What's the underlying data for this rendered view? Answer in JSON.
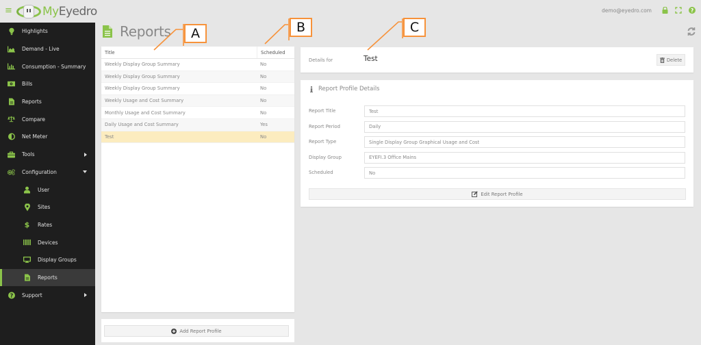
{
  "app": {
    "brand_my": "My",
    "brand_rest": "Eyedro",
    "user_email": "demo@eyedro.com"
  },
  "sidebar": {
    "items": [
      {
        "label": "Highlights",
        "icon": "lightbulb-icon"
      },
      {
        "label": "Demand - Live",
        "icon": "area-chart-icon"
      },
      {
        "label": "Consumption - Summary",
        "icon": "bar-chart-icon"
      },
      {
        "label": "Bills",
        "icon": "money-icon"
      },
      {
        "label": "Reports",
        "icon": "document-icon"
      },
      {
        "label": "Compare",
        "icon": "balance-scale-icon"
      },
      {
        "label": "Net Meter",
        "icon": "half-circle-icon"
      },
      {
        "label": "Tools",
        "icon": "briefcase-icon",
        "expand": "right"
      },
      {
        "label": "Configuration",
        "icon": "cogs-icon",
        "expand": "down"
      },
      {
        "label": "User",
        "icon": "user-icon",
        "sub": true
      },
      {
        "label": "Sites",
        "icon": "map-marker-icon",
        "sub": true
      },
      {
        "label": "Rates",
        "icon": "dollar-icon",
        "sub": true
      },
      {
        "label": "Devices",
        "icon": "barcode-icon",
        "sub": true
      },
      {
        "label": "Display Groups",
        "icon": "monitor-icon",
        "sub": true
      },
      {
        "label": "Reports",
        "icon": "document-icon",
        "sub": true,
        "active": true
      },
      {
        "label": "Support",
        "icon": "question-circle-icon",
        "expand": "right"
      }
    ]
  },
  "page": {
    "title": "Reports"
  },
  "report_list": {
    "columns": [
      "Title",
      "Scheduled"
    ],
    "rows": [
      {
        "title": "Weekly Display Group Summary",
        "scheduled": "No"
      },
      {
        "title": "Weekly Display Group Summary",
        "scheduled": "No"
      },
      {
        "title": "Weekly Display Group Summary",
        "scheduled": "No"
      },
      {
        "title": "Weekly Usage and Cost Summary",
        "scheduled": "No"
      },
      {
        "title": "Monthly Usage and Cost Summary",
        "scheduled": "No"
      },
      {
        "title": "Daily Usage and Cost Summary",
        "scheduled": "Yes"
      },
      {
        "title": "Test",
        "scheduled": "No",
        "selected": true
      }
    ],
    "add_button": "Add Report Profile"
  },
  "details": {
    "label": "Details for",
    "name": "Test",
    "delete_button": "Delete"
  },
  "profile": {
    "title": "Report Profile Details",
    "fields": [
      {
        "label": "Report Title",
        "value": "Test"
      },
      {
        "label": "Report Period",
        "value": "Daily"
      },
      {
        "label": "Report Type",
        "value": "Single Display Group Graphical Usage and Cost"
      },
      {
        "label": "Display Group",
        "value": "EYEFI.3 Office Mains"
      },
      {
        "label": "Scheduled",
        "value": "No"
      }
    ],
    "edit_button": "Edit Report Profile"
  },
  "callouts": [
    "A",
    "B",
    "C"
  ],
  "colors": {
    "accent": "#8bc34a",
    "sidebar_bg": "#1e1e1e",
    "selected_row": "#fcecbf",
    "callout": "#f7923a"
  }
}
